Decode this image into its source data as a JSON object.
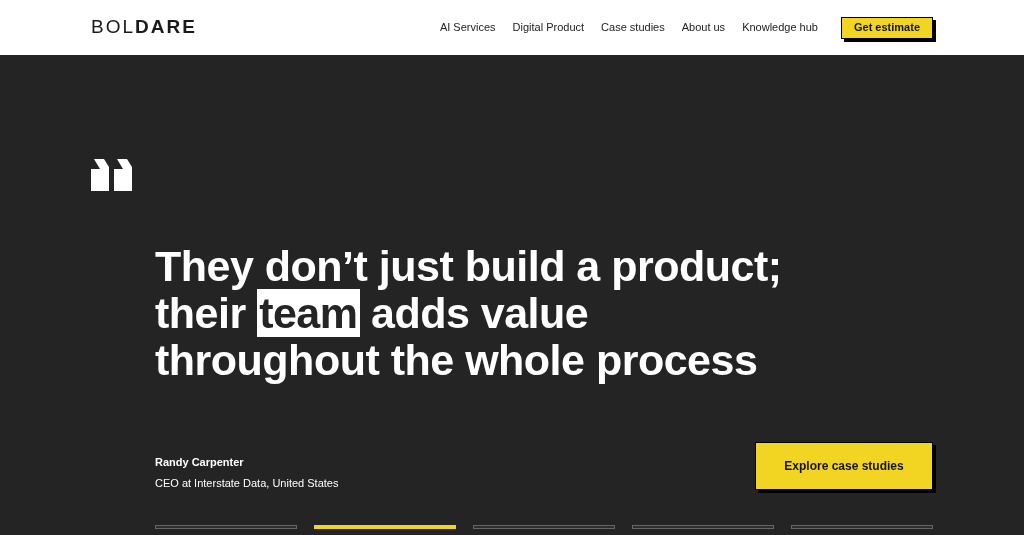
{
  "header": {
    "logo": "BOL**DARE**",
    "nav": [
      "AI Services",
      "Digital Product",
      "Case studies",
      "About us",
      "Knowledge hub"
    ],
    "cta": "Get estimate"
  },
  "testimonial": {
    "lines": [
      [
        {
          "text": "They don’t just build a product;",
          "highlighted": false
        }
      ],
      [
        {
          "text": "their ",
          "highlighted": false
        },
        {
          "text": "team",
          "highlighted": true
        },
        {
          "text": " adds value",
          "highlighted": false
        }
      ],
      [
        {
          "text": "throughout the whole process",
          "highlighted": false
        }
      ]
    ],
    "author": "Randy Carpenter",
    "role": "CEO at Interstate Data, United States",
    "button": "Explore case studies",
    "slides": [
      {
        "selected": false
      },
      {
        "selected": true
      },
      {
        "selected": false
      },
      {
        "selected": false
      },
      {
        "selected": false
      }
    ]
  }
}
